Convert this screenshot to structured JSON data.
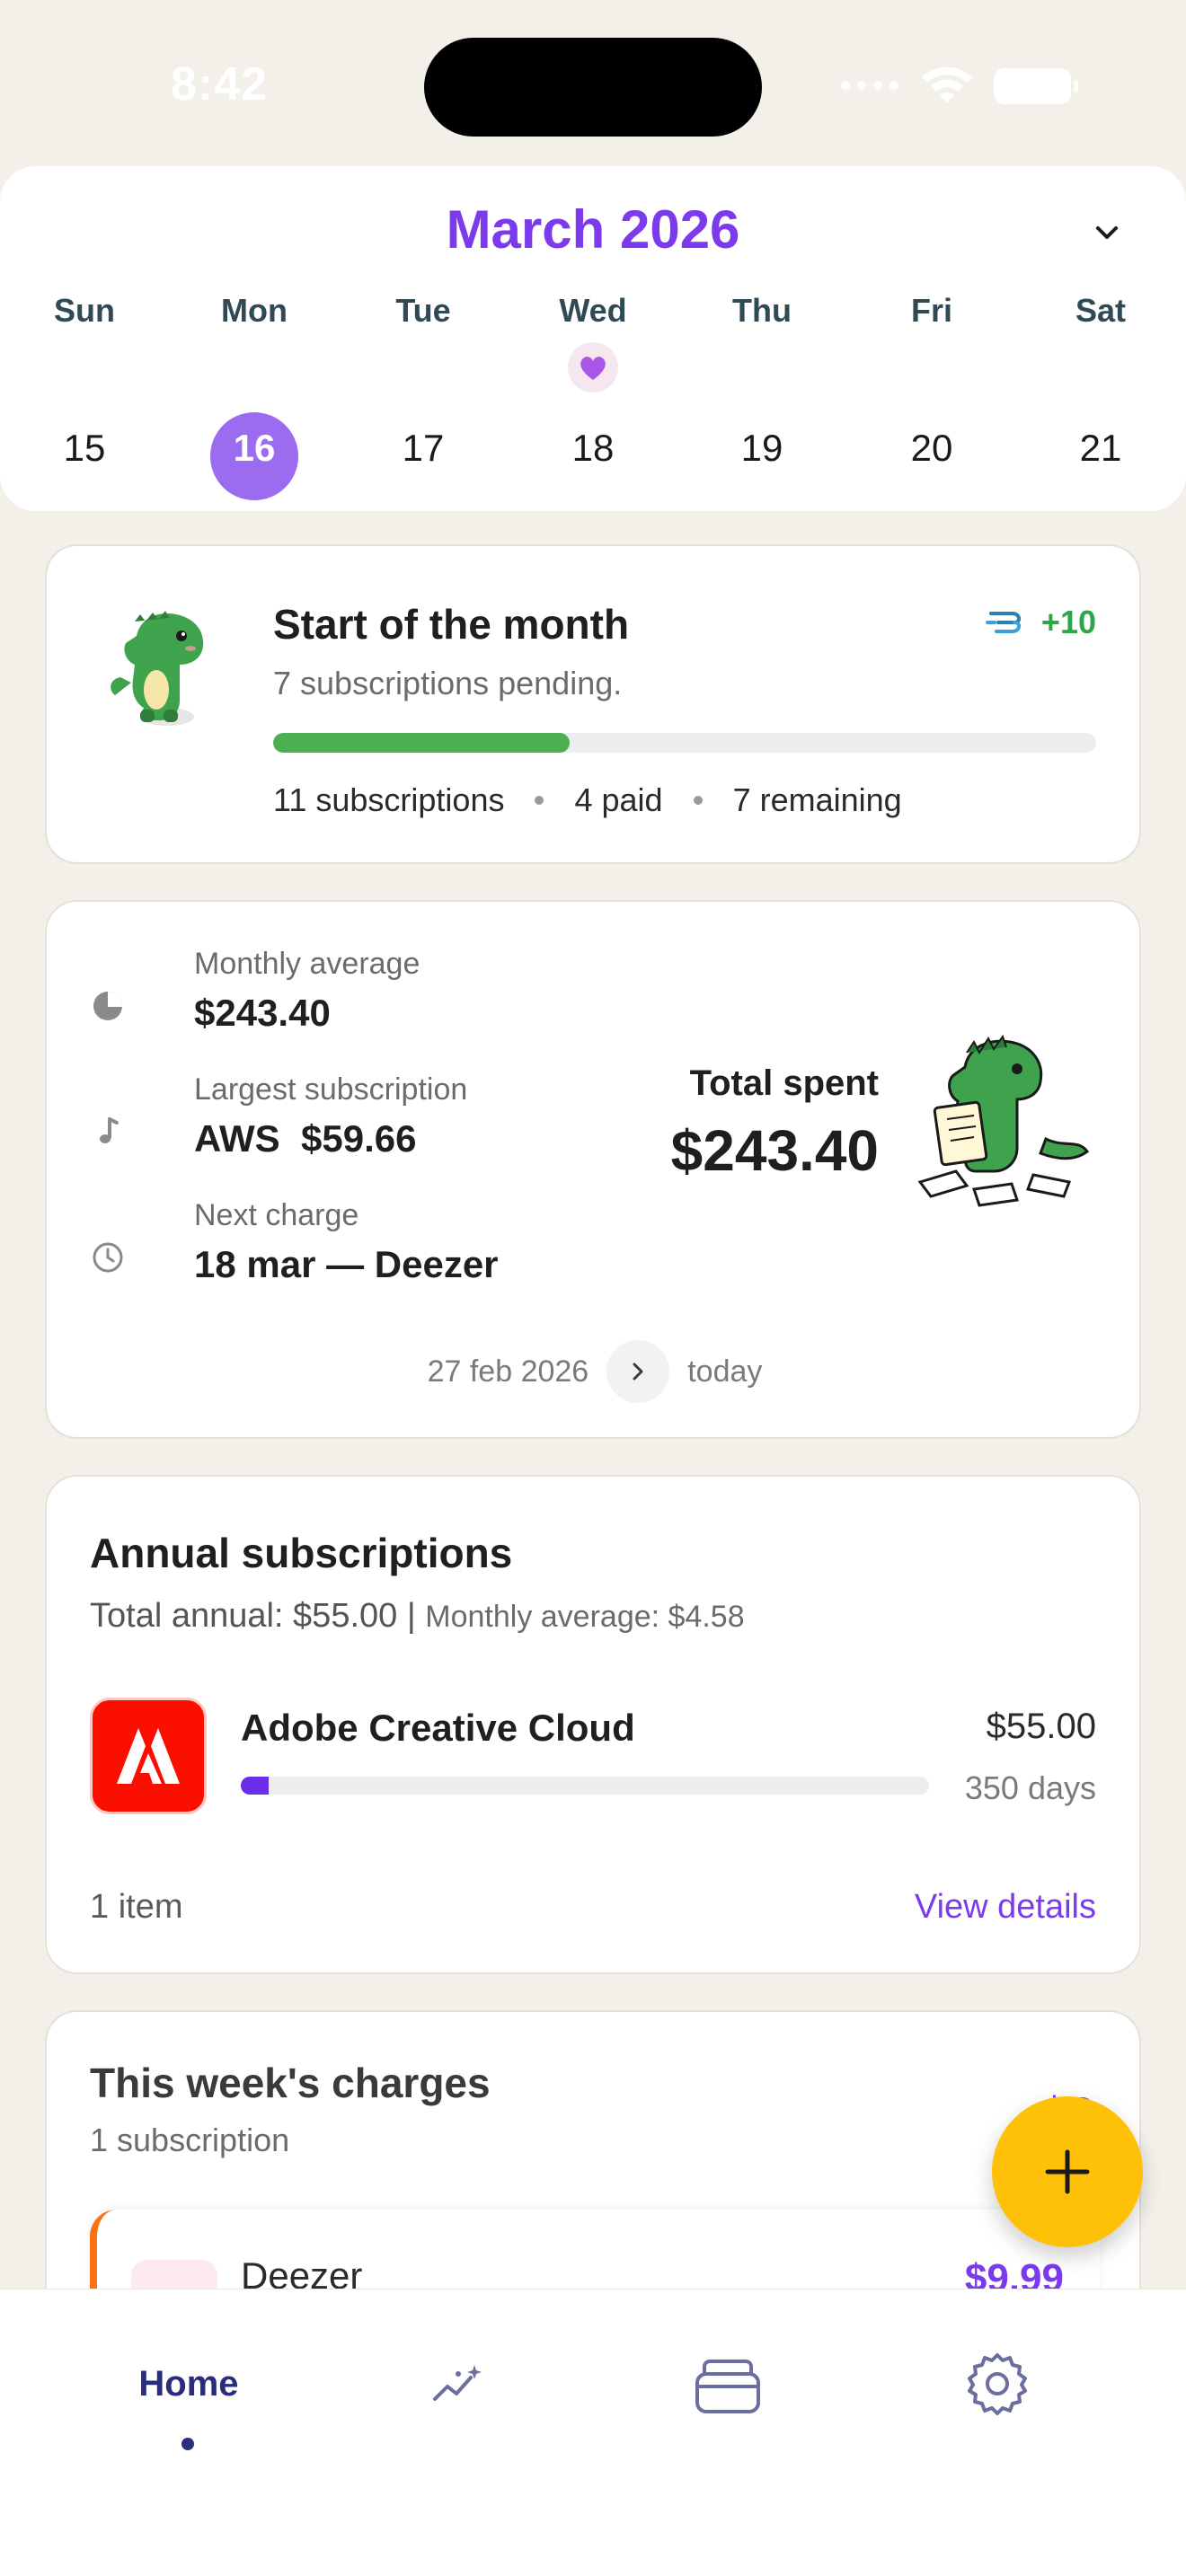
{
  "status_bar": {
    "time": "8:42"
  },
  "calendar": {
    "month_title": "March 2026",
    "days": [
      {
        "name": "Sun",
        "num": "15"
      },
      {
        "name": "Mon",
        "num": "16"
      },
      {
        "name": "Tue",
        "num": "17"
      },
      {
        "name": "Wed",
        "num": "18"
      },
      {
        "name": "Thu",
        "num": "19"
      },
      {
        "name": "Fri",
        "num": "20"
      },
      {
        "name": "Sat",
        "num": "21"
      }
    ],
    "selected_day": "16",
    "marker_day": "18",
    "marker_icon": "heart-icon"
  },
  "month_progress": {
    "title": "Start of the month",
    "subtitle": "7 subscriptions pending.",
    "xp": "+10",
    "progress_fraction": 0.36,
    "stat_subscriptions": "11 subscriptions",
    "stat_paid": "4 paid",
    "stat_remaining": "7 remaining",
    "colors": {
      "bar": "#4caf50",
      "xp": "#2fa64a"
    }
  },
  "summary": {
    "monthly_average_label": "Monthly average",
    "monthly_average_value": "$243.40",
    "largest_label": "Largest subscription",
    "largest_value": "AWS  $59.66",
    "next_charge_label": "Next charge",
    "next_charge_value": "18 mar — Deezer",
    "total_label": "Total spent",
    "total_value": "$243.40",
    "range_start": "27 feb 2026",
    "range_end": "today"
  },
  "annual": {
    "title": "Annual subscriptions",
    "total_annual": "Total annual: $55.00",
    "separator": "|",
    "monthly_average": "Monthly average: $4.58",
    "item_name": "Adobe Creative Cloud",
    "item_price": "$55.00",
    "item_days": "350 days",
    "item_progress_fraction": 0.04,
    "count": "1 item",
    "link": "View details"
  },
  "week": {
    "title": "This week's charges",
    "subtitle": "1 subscription",
    "total": "$9",
    "item_name": "Deezer",
    "item_price": "$9.99"
  },
  "tabbar": {
    "home_label": "Home",
    "tabs": [
      "home",
      "insights-icon",
      "cards-icon",
      "gear-icon"
    ]
  },
  "colors": {
    "accent": "#7c3aed",
    "fab": "#ffc107",
    "background": "#f3f0e9"
  }
}
